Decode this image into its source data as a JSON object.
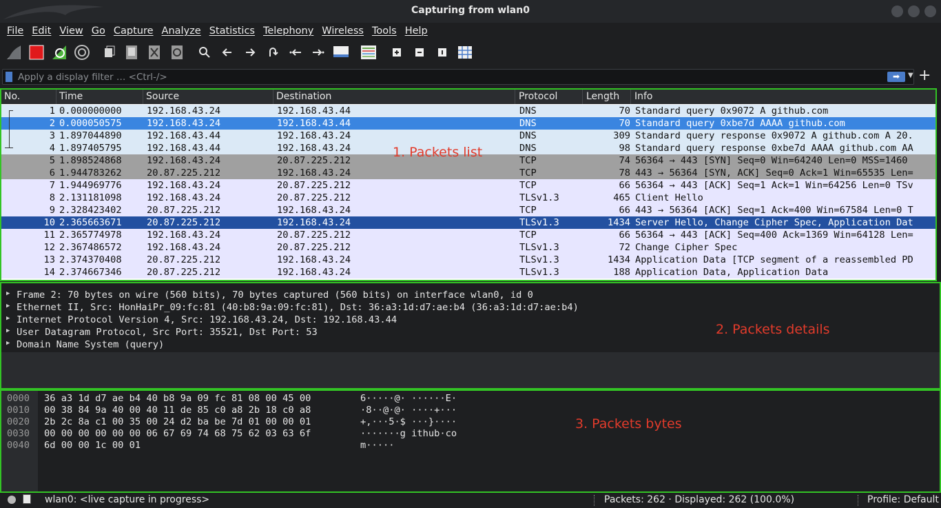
{
  "window": {
    "title": "Capturing from wlan0"
  },
  "menu": [
    "File",
    "Edit",
    "View",
    "Go",
    "Capture",
    "Analyze",
    "Statistics",
    "Telephony",
    "Wireless",
    "Tools",
    "Help"
  ],
  "toolbar": [
    "shark-fin-start",
    "stop-capture",
    "restart-capture",
    "capture-options",
    "open-file",
    "save-file",
    "close-file",
    "reload-file",
    "find-packet",
    "go-back",
    "go-forward",
    "go-to-packet",
    "go-first",
    "go-last",
    "auto-scroll",
    "colorize",
    "zoom-in",
    "zoom-out",
    "zoom-normal",
    "resize-columns"
  ],
  "filter": {
    "placeholder": "Apply a display filter … <Ctrl-/>"
  },
  "packet_list": {
    "columns": [
      "No.",
      "Time",
      "Source",
      "Destination",
      "Protocol",
      "Length",
      "Info"
    ],
    "rows": [
      {
        "no": "1",
        "time": "0.000000000",
        "src": "192.168.43.24",
        "dst": "192.168.43.44",
        "proto": "DNS",
        "len": "70",
        "info": "Standard query 0x9072 A github.com",
        "bg": "#dbe9f6",
        "fg": "#111111"
      },
      {
        "no": "2",
        "time": "0.000050575",
        "src": "192.168.43.24",
        "dst": "192.168.43.44",
        "proto": "DNS",
        "len": "70",
        "info": "Standard query 0xbe7d AAAA github.com",
        "bg": "#3a85e0",
        "fg": "#ffffff"
      },
      {
        "no": "3",
        "time": "1.897044890",
        "src": "192.168.43.44",
        "dst": "192.168.43.24",
        "proto": "DNS",
        "len": "309",
        "info": "Standard query response 0x9072 A github.com A 20.",
        "bg": "#dbe9f6",
        "fg": "#111111"
      },
      {
        "no": "4",
        "time": "1.897405795",
        "src": "192.168.43.44",
        "dst": "192.168.43.24",
        "proto": "DNS",
        "len": "98",
        "info": "Standard query response 0xbe7d AAAA github.com AA",
        "bg": "#dbe9f6",
        "fg": "#111111"
      },
      {
        "no": "5",
        "time": "1.898524868",
        "src": "192.168.43.24",
        "dst": "20.87.225.212",
        "proto": "TCP",
        "len": "74",
        "info": "56364 → 443 [SYN] Seq=0 Win=64240 Len=0 MSS=1460",
        "bg": "#a0a0a0",
        "fg": "#111111"
      },
      {
        "no": "6",
        "time": "1.944783262",
        "src": "20.87.225.212",
        "dst": "192.168.43.24",
        "proto": "TCP",
        "len": "78",
        "info": "443 → 56364 [SYN, ACK] Seq=0 Ack=1 Win=65535 Len=",
        "bg": "#a0a0a0",
        "fg": "#111111"
      },
      {
        "no": "7",
        "time": "1.944969776",
        "src": "192.168.43.24",
        "dst": "20.87.225.212",
        "proto": "TCP",
        "len": "66",
        "info": "56364 → 443 [ACK] Seq=1 Ack=1 Win=64256 Len=0 TSv",
        "bg": "#e7e6ff",
        "fg": "#111111"
      },
      {
        "no": "8",
        "time": "2.131181098",
        "src": "192.168.43.24",
        "dst": "20.87.225.212",
        "proto": "TLSv1.3",
        "len": "465",
        "info": "Client Hello",
        "bg": "#e7e6ff",
        "fg": "#111111"
      },
      {
        "no": "9",
        "time": "2.328423402",
        "src": "20.87.225.212",
        "dst": "192.168.43.24",
        "proto": "TCP",
        "len": "66",
        "info": "443 → 56364 [ACK] Seq=1 Ack=400 Win=67584 Len=0 T",
        "bg": "#e7e6ff",
        "fg": "#111111"
      },
      {
        "no": "10",
        "time": "2.365663671",
        "src": "20.87.225.212",
        "dst": "192.168.43.24",
        "proto": "TLSv1.3",
        "len": "1434",
        "info": "Server Hello, Change Cipher Spec, Application Dat",
        "bg": "#2350a0",
        "fg": "#ffffff"
      },
      {
        "no": "11",
        "time": "2.365774978",
        "src": "192.168.43.24",
        "dst": "20.87.225.212",
        "proto": "TCP",
        "len": "66",
        "info": "56364 → 443 [ACK] Seq=400 Ack=1369 Win=64128 Len=",
        "bg": "#e7e6ff",
        "fg": "#111111"
      },
      {
        "no": "12",
        "time": "2.367486572",
        "src": "192.168.43.24",
        "dst": "20.87.225.212",
        "proto": "TLSv1.3",
        "len": "72",
        "info": "Change Cipher Spec",
        "bg": "#e7e6ff",
        "fg": "#111111"
      },
      {
        "no": "13",
        "time": "2.374370408",
        "src": "20.87.225.212",
        "dst": "192.168.43.24",
        "proto": "TLSv1.3",
        "len": "1434",
        "info": "Application Data [TCP segment of a reassembled PD",
        "bg": "#e7e6ff",
        "fg": "#111111"
      },
      {
        "no": "14",
        "time": "2.374667346",
        "src": "20.87.225.212",
        "dst": "192.168.43.24",
        "proto": "TLSv1.3",
        "len": "188",
        "info": "Application Data, Application Data",
        "bg": "#e7e6ff",
        "fg": "#111111"
      }
    ],
    "annotation": "1. Packets list"
  },
  "details": {
    "lines": [
      "Frame 2: 70 bytes on wire (560 bits), 70 bytes captured (560 bits) on interface wlan0, id 0",
      "Ethernet II, Src: HonHaiPr_09:fc:81 (40:b8:9a:09:fc:81), Dst: 36:a3:1d:d7:ae:b4 (36:a3:1d:d7:ae:b4)",
      "Internet Protocol Version 4, Src: 192.168.43.24, Dst: 192.168.43.44",
      "User Datagram Protocol, Src Port: 35521, Dst Port: 53",
      "Domain Name System (query)"
    ],
    "annotation": "2. Packets details"
  },
  "bytes": {
    "rows": [
      {
        "offset": "0000",
        "hex": "36 a3 1d d7 ae b4 40 b8  9a 09 fc 81 08 00 45 00",
        "ascii": "6·····@· ······E·"
      },
      {
        "offset": "0010",
        "hex": "00 38 84 9a 40 00 40 11  de 85 c0 a8 2b 18 c0 a8",
        "ascii": "·8··@·@· ····+···"
      },
      {
        "offset": "0020",
        "hex": "2b 2c 8a c1 00 35 00 24  d2 ba be 7d 01 00 00 01",
        "ascii": "+,···5·$ ···}····"
      },
      {
        "offset": "0030",
        "hex": "00 00 00 00 00 00 06 67  69 74 68 75 62 03 63 6f",
        "ascii": "·······g ithub·co"
      },
      {
        "offset": "0040",
        "hex": "6d 00 00 1c 00 01",
        "ascii": "m·····"
      }
    ],
    "annotation": "3. Packets bytes"
  },
  "status": {
    "interface": "wlan0: <live capture in progress>",
    "packets": "Packets: 262 · Displayed: 262 (100.0%)",
    "profile": "Profile: Default"
  }
}
